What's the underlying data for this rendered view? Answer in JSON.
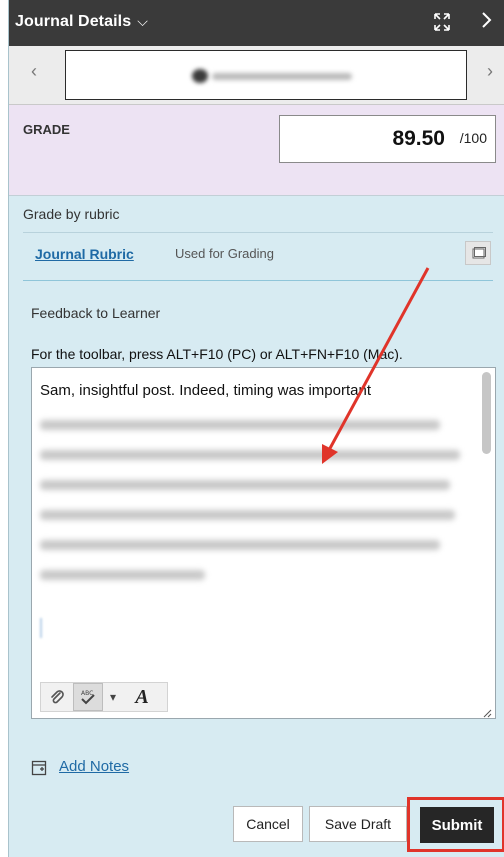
{
  "header": {
    "title": "Journal Details",
    "title_chevron": "chevron-down-icon",
    "expand_icon": "expand-icon",
    "next_icon": "chevron-right-icon"
  },
  "learner_nav": {
    "prev_glyph": "‹",
    "next_glyph": "›"
  },
  "grade": {
    "label": "GRADE",
    "score": "89.50",
    "max": "/100"
  },
  "rubric": {
    "label": "Grade by rubric",
    "link": "Journal Rubric",
    "status": "Used for Grading",
    "open_icon": "window-icon"
  },
  "feedback": {
    "label": "Feedback to Learner",
    "toolbar_hint": "For the toolbar, press ALT+F10 (PC) or ALT+FN+F10 (Mac).",
    "first_line": "Sam, insightful post. Indeed, timing was important"
  },
  "notes": {
    "link": "Add Notes"
  },
  "actions": {
    "cancel": "Cancel",
    "save_draft": "Save Draft",
    "submit": "Submit"
  },
  "colors": {
    "panel_bg": "#d7ebf2",
    "header_bg": "#3a3a3a",
    "grade_bg": "#ede3f3",
    "link": "#1f6aa5",
    "highlight": "#e0342a"
  }
}
